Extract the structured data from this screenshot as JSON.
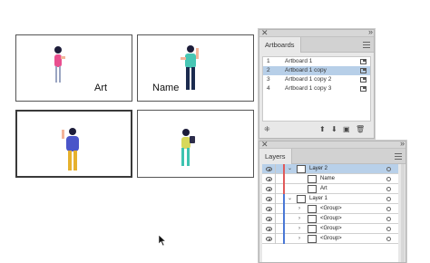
{
  "artboards": {
    "label_name": "Name",
    "label_art": "Art"
  },
  "artboards_panel": {
    "tab": "Artboards",
    "rows": [
      {
        "num": "1",
        "name": "Artboard 1"
      },
      {
        "num": "2",
        "name": "Artboard 1 copy"
      },
      {
        "num": "3",
        "name": "Artboard 1 copy 2"
      },
      {
        "num": "4",
        "name": "Artboard 1 copy 3"
      }
    ],
    "selected_row": "2"
  },
  "layers_panel": {
    "tab": "Layers",
    "rows": [
      {
        "name": "Layer 2"
      },
      {
        "name": "Name"
      },
      {
        "name": "Art"
      },
      {
        "name": "Layer 1"
      },
      {
        "name": "<Group>"
      },
      {
        "name": "<Group>"
      },
      {
        "name": "<Group>"
      },
      {
        "name": "<Group>"
      }
    ]
  },
  "colors": {
    "selection": "#b7cfe8",
    "layer2_color": "#e05a5a",
    "layer1_color": "#4a78d6"
  }
}
